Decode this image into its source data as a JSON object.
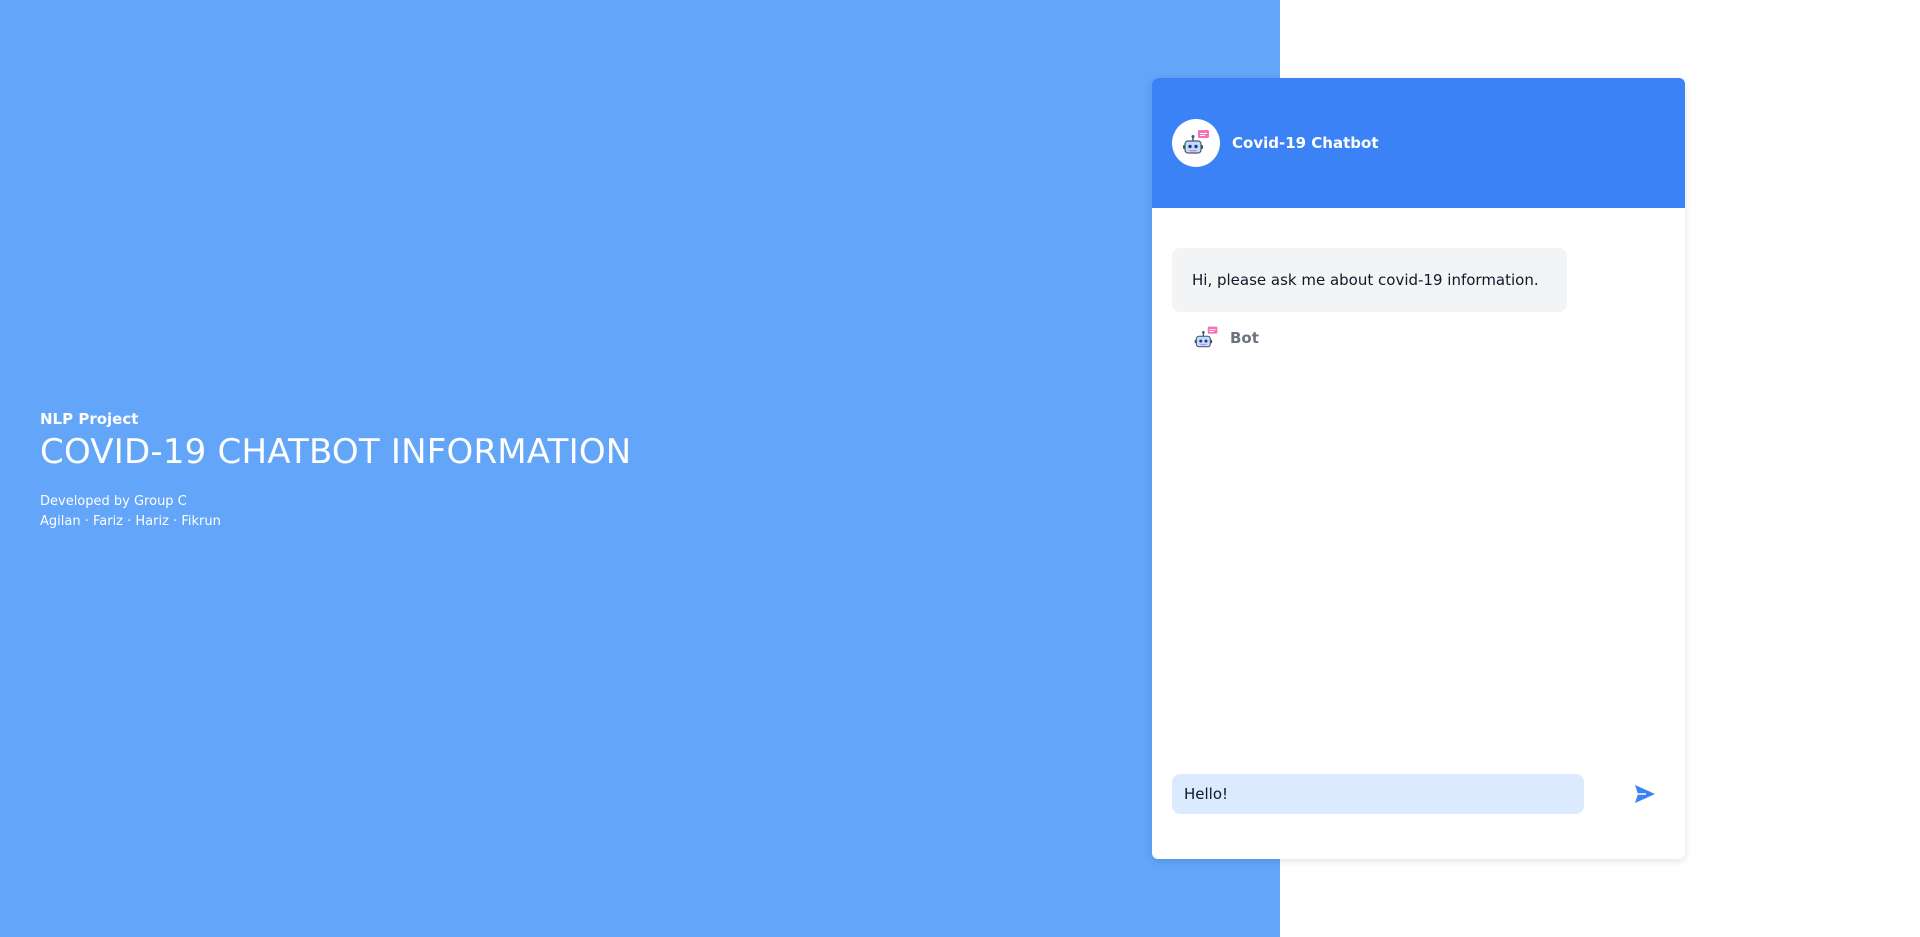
{
  "hero": {
    "eyebrow": "NLP Project",
    "title": "COVID-19 CHATBOT INFORMATION",
    "developed_by": "Developed by Group C",
    "members": "Agilan · Fariz · Hariz · Fikrun"
  },
  "chat": {
    "title": "Covid-19 Chatbot",
    "avatar_icon": "robot-icon",
    "messages": [
      {
        "text": "Hi, please ask me about covid-19 information.",
        "sender": "Bot",
        "sender_icon": "robot-icon"
      }
    ],
    "input_value": "Hello!",
    "send_icon": "send-icon"
  },
  "colors": {
    "left_panel": "#62a5f9",
    "header": "#3b82f6",
    "input_bg": "#dbeafe",
    "bubble_bg": "#f3f4f6"
  }
}
